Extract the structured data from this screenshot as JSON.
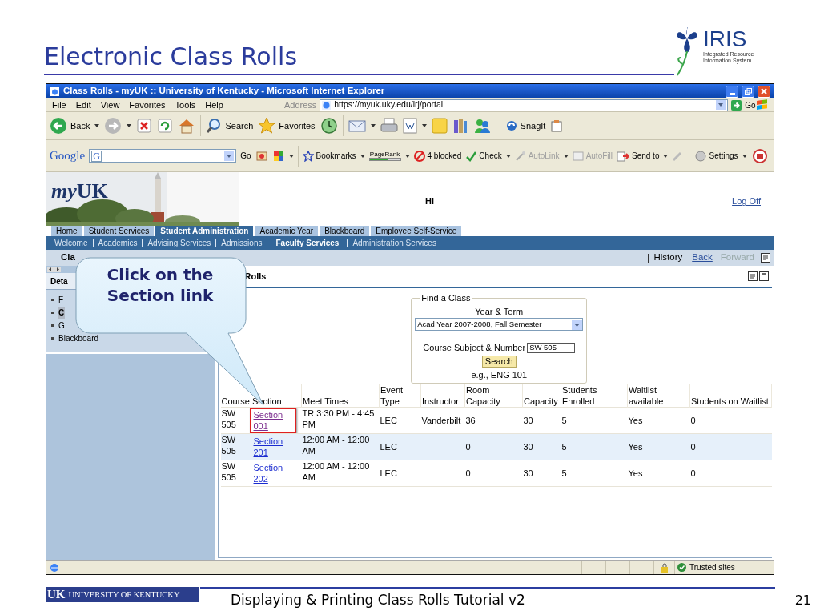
{
  "slide": {
    "title": "Electronic Class Rolls",
    "logo": {
      "name": "IRIS",
      "tagline_1": "Integrated Resource",
      "tagline_2": "Information System"
    },
    "footer_logo": {
      "mark": "UK",
      "name": "UNIVERSITY OF KENTUCKY"
    },
    "footer_text": "Displaying & Printing Class Rolls Tutorial v2",
    "page_number": "21"
  },
  "window": {
    "title": "Class Rolls - myUK :: University of Kentucky - Microsoft Internet Explorer"
  },
  "menu": [
    "File",
    "Edit",
    "View",
    "Favorites",
    "Tools",
    "Help"
  ],
  "address": {
    "label": "Address",
    "value": "https://myuk.uky.edu/irj/portal",
    "go": "Go"
  },
  "toolbar": {
    "back": "Back",
    "search": "Search",
    "favorites": "Favorites",
    "snagit": "SnagIt"
  },
  "google_bar": {
    "logo": "Google",
    "field_logo": "G",
    "go": "Go",
    "bookmarks": "Bookmarks",
    "pagerank": {
      "label": "PageRank",
      "level": 0.6
    },
    "items": [
      {
        "label": "4 blocked",
        "disabled": false
      },
      {
        "label": "Check",
        "disabled": false
      },
      {
        "label": "AutoLink",
        "disabled": true
      },
      {
        "label": "AutoFill",
        "disabled": true
      },
      {
        "label": "Send to",
        "disabled": false
      }
    ],
    "settings": "Settings"
  },
  "portal": {
    "logo_prefix": "my",
    "logo_main": "UK",
    "greeting": "Hi",
    "log_off": "Log Off",
    "tabs": [
      {
        "label": "Home",
        "selected": false
      },
      {
        "label": "Student Services",
        "selected": false
      },
      {
        "label": "Student Administration",
        "selected": true
      },
      {
        "label": "Academic Year",
        "selected": false
      },
      {
        "label": "Blackboard",
        "selected": false
      },
      {
        "label": "Employee Self-Service",
        "selected": false
      }
    ],
    "subnav": [
      {
        "label": "Welcome",
        "selected": false
      },
      {
        "label": "Academics",
        "selected": false
      },
      {
        "label": "Advising Services",
        "selected": false
      },
      {
        "label": "Admissions",
        "selected": false
      },
      {
        "label": "Faculty Services",
        "selected": true
      },
      {
        "label": "Administration Services",
        "selected": false
      }
    ],
    "page_title": "Cla",
    "history": "History",
    "back": {
      "label": "Back",
      "disabled": false
    },
    "forward": {
      "label": "Forward",
      "disabled": true
    }
  },
  "nav": {
    "header": "Deta",
    "items": [
      {
        "label": "F",
        "selected": false
      },
      {
        "label": "C",
        "selected": true
      },
      {
        "label": "G",
        "selected": false
      },
      {
        "label": "Blackboard",
        "selected": false
      }
    ]
  },
  "iview": {
    "title": "Rolls"
  },
  "find_class": {
    "legend": "Find a Class",
    "year_label": "Year & Term",
    "term": "Acad Year 2007-2008, Fall Semester",
    "course_label": "Course Subject & Number",
    "course_value": "SW 505",
    "search": "Search",
    "example": "e.g., ENG 101"
  },
  "table": {
    "columns": [
      "Course",
      "Section",
      "Meet Times",
      "Event Type",
      "Instructor",
      "Room Capacity",
      "Capacity",
      "Students Enrolled",
      "Waitlist available",
      "Students on Waitlist"
    ],
    "rows": [
      {
        "cells": [
          "SW 505",
          "Section 001",
          "TR 3:30 PM - 4:45 PM",
          "LEC",
          "Vanderbilt",
          "36",
          "30",
          "5",
          "Yes",
          "0"
        ],
        "visited": true,
        "highlighted": true,
        "hovered": false
      },
      {
        "cells": [
          "SW 505",
          "Section 201",
          "12:00 AM - 12:00 AM",
          "LEC",
          "",
          "0",
          "30",
          "5",
          "Yes",
          "0"
        ],
        "visited": false,
        "highlighted": false,
        "hovered": true
      },
      {
        "cells": [
          "SW 505",
          "Section 202",
          "12:00 AM - 12:00 AM",
          "LEC",
          "",
          "0",
          "30",
          "5",
          "Yes",
          "0"
        ],
        "visited": false,
        "highlighted": false,
        "hovered": false
      }
    ]
  },
  "status_bar": {
    "zone": "Trusted sites"
  },
  "callout": {
    "text": "Click on the Section link"
  }
}
